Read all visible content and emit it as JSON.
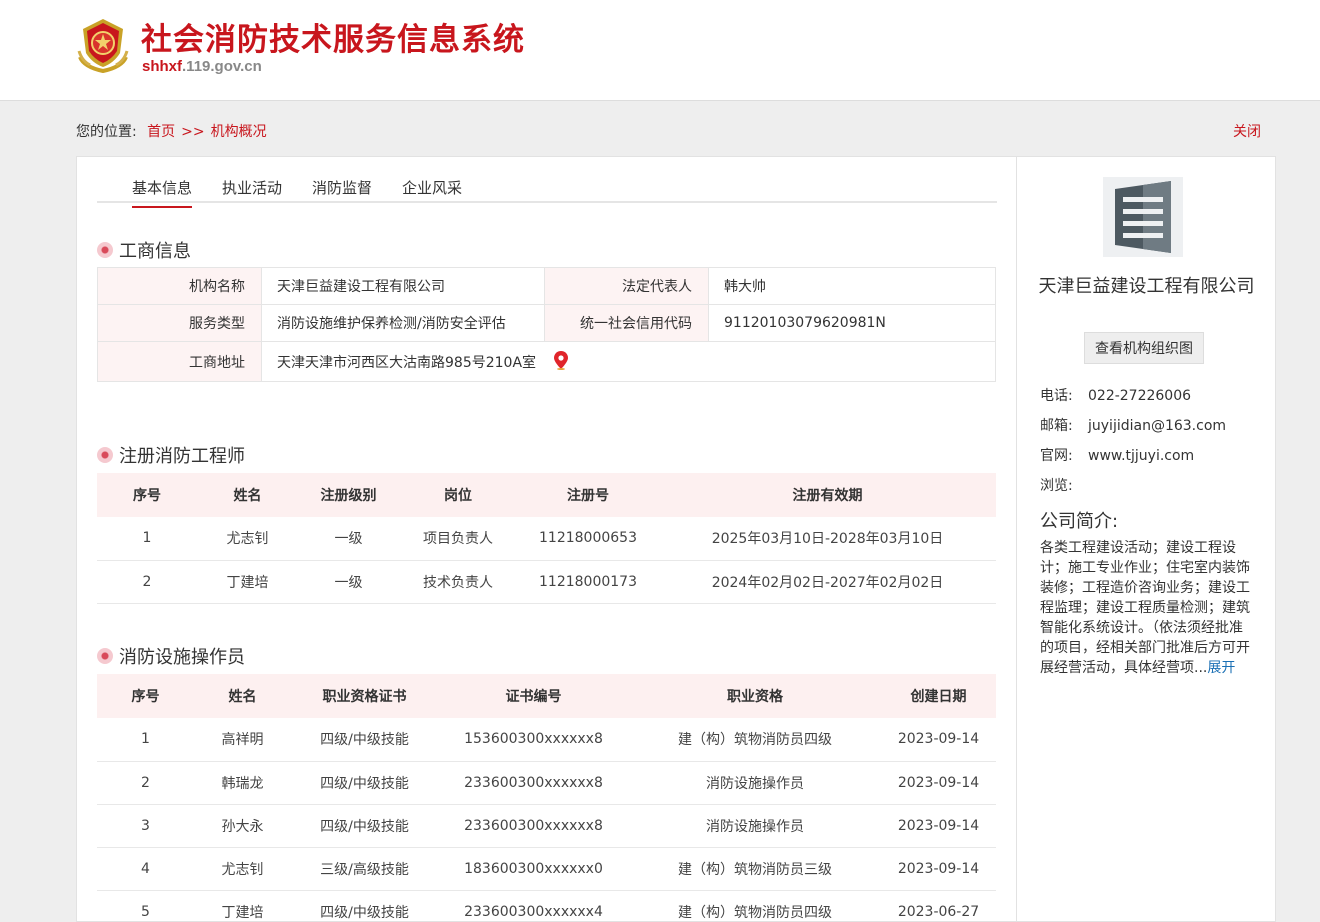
{
  "header": {
    "title": "社会消防技术服务信息系统",
    "url_bold": "shhxf",
    "url_rest": ".119.gov.cn"
  },
  "breadcrumb": {
    "label": "您的位置:",
    "home": "首页",
    "sep": ">>",
    "current": "机构概况",
    "close": "关闭"
  },
  "tabs": [
    "基本信息",
    "执业活动",
    "消防监督",
    "企业风采"
  ],
  "business": {
    "title": "工商信息",
    "org_name_label": "机构名称",
    "org_name": "天津巨益建设工程有限公司",
    "legal_rep_label": "法定代表人",
    "legal_rep": "韩大帅",
    "service_type_label": "服务类型",
    "service_type": "消防设施维护保养检测/消防安全评估",
    "credit_code_label": "统一社会信用代码",
    "credit_code": "91120103079620981N",
    "address_label": "工商地址",
    "address": "天津天津市河西区大沽南路985号210A室"
  },
  "engineers": {
    "title": "注册消防工程师",
    "headers": [
      "序号",
      "姓名",
      "注册级别",
      "岗位",
      "注册号",
      "注册有效期"
    ],
    "rows": [
      [
        "1",
        "尤志钊",
        "一级",
        "项目负责人",
        "11218000653",
        "2025年03月10日-2028年03月10日"
      ],
      [
        "2",
        "丁建培",
        "一级",
        "技术负责人",
        "11218000173",
        "2024年02月02日-2027年02月02日"
      ]
    ]
  },
  "operators": {
    "title": "消防设施操作员",
    "headers": [
      "序号",
      "姓名",
      "职业资格证书",
      "证书编号",
      "职业资格",
      "创建日期"
    ],
    "rows": [
      [
        "1",
        "高祥明",
        "四级/中级技能",
        "153600300xxxxxx8",
        "建（构）筑物消防员四级",
        "2023-09-14"
      ],
      [
        "2",
        "韩瑞龙",
        "四级/中级技能",
        "233600300xxxxxx8",
        "消防设施操作员",
        "2023-09-14"
      ],
      [
        "3",
        "孙大永",
        "四级/中级技能",
        "233600300xxxxxx8",
        "消防设施操作员",
        "2023-09-14"
      ],
      [
        "4",
        "尤志钊",
        "三级/高级技能",
        "183600300xxxxxx0",
        "建（构）筑物消防员三级",
        "2023-09-14"
      ],
      [
        "5",
        "丁建培",
        "四级/中级技能",
        "233600300xxxxxx4",
        "建（构）筑物消防员四级",
        "2023-06-27"
      ]
    ]
  },
  "side": {
    "company_name": "天津巨益建设工程有限公司",
    "org_chart_button": "查看机构组织图",
    "phone_label": "电话:",
    "phone": "022-27226006",
    "email_label": "邮箱:",
    "email": "juyijidian@163.com",
    "website_label": "官网:",
    "website": "www.tjjuyi.com",
    "views_label": "浏览:",
    "views": "",
    "intro_title": "公司简介:",
    "intro_text": "各类工程建设活动；建设工程设计；施工专业作业；住宅室内装饰装修；工程造价咨询业务；建设工程监理；建设工程质量检测；建筑智能化系统设计。（依法须经批准的项目，经相关部门批准后方可开展经营活动，具体经营项...",
    "expand": "展开"
  },
  "colors": {
    "brand_red": "#c8161d",
    "pink_bg": "#fdf0f0",
    "link_blue": "#1a6fb4"
  },
  "icons": [
    "emblem-icon",
    "section-dot-icon",
    "location-pin-icon",
    "company-logo-icon"
  ]
}
